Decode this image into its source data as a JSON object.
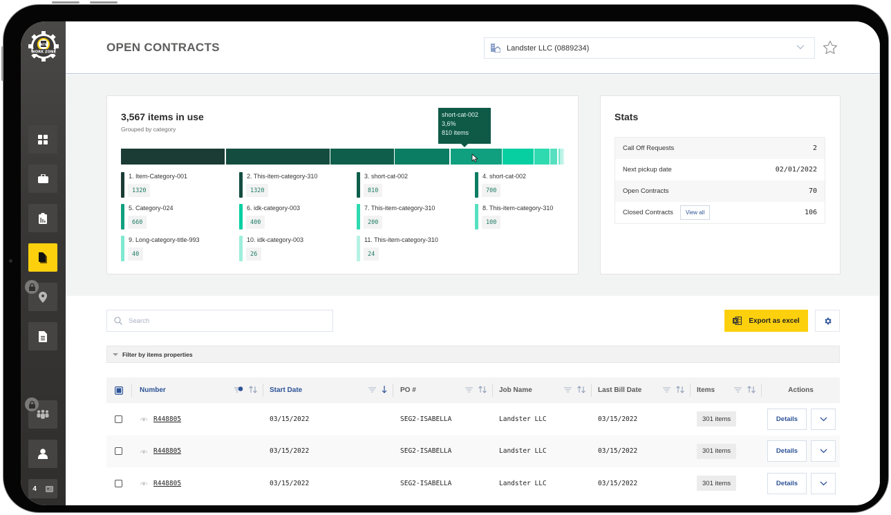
{
  "app": {
    "logo_label": "NTS WORK ZONE",
    "page_title": "OPEN CONTRACTS"
  },
  "sidebar": {
    "items": [
      {
        "name": "dashboard",
        "icon": "grid-icon",
        "active": false,
        "locked": false
      },
      {
        "name": "jobs",
        "icon": "briefcase-icon",
        "active": false,
        "locked": false
      },
      {
        "name": "reports",
        "icon": "clipboard-chart-icon",
        "active": false,
        "locked": false
      },
      {
        "name": "contracts",
        "icon": "documents-icon",
        "active": true,
        "locked": false
      },
      {
        "name": "locations",
        "icon": "location-pin-icon",
        "active": false,
        "locked": true
      },
      {
        "name": "invoices",
        "icon": "document-list-icon",
        "active": false,
        "locked": false
      },
      {
        "name": "team",
        "icon": "group-icon",
        "active": false,
        "locked": true
      },
      {
        "name": "profile",
        "icon": "user-icon",
        "active": false,
        "locked": false
      }
    ],
    "message_count": "4"
  },
  "header": {
    "company_select": {
      "value": "Landster LLC (0889234)",
      "icon": "buildings-icon"
    },
    "favorite_icon": "star-icon"
  },
  "usage_chart": {
    "title": "3,567 items in use",
    "subtitle": "Grouped by category",
    "tooltip": {
      "name": "short-cat-002",
      "percent": "3,6%",
      "items": "810 items"
    }
  },
  "chart_data": {
    "type": "bar",
    "subtype": "stacked-horizontal",
    "title": "3,567 items in use",
    "subtitle": "Grouped by category",
    "categories": [
      "1. Item-Category-001",
      "2. This-item-category-310",
      "3. short-cat-002",
      "4. short-cat-002",
      "5. Category-024",
      "6. idk-category-003",
      "7. This-item-category-310",
      "8. This-item-category-310",
      "9. Long-category-title-993",
      "10. idk-category-003",
      "11. This-item-category-310"
    ],
    "values": [
      1320,
      1320,
      810,
      700,
      660,
      400,
      200,
      100,
      40,
      26,
      24
    ],
    "value_labels": [
      "1320",
      "1320",
      "810",
      "700",
      "660",
      "400",
      "200",
      "100",
      "40",
      "26",
      "24"
    ],
    "colors": [
      "#1a3c34",
      "#144d40",
      "#0f5e4b",
      "#0b7d62",
      "#10a07f",
      "#08cfa2",
      "#2fdab0",
      "#56e0c0",
      "#7fe8d0",
      "#9eeedb",
      "#b6f2e4"
    ],
    "hovered_index": 4,
    "legend": "bottom"
  },
  "stats": {
    "title": "Stats",
    "rows": [
      {
        "label": "Call Off Requests",
        "value": "2"
      },
      {
        "label": "Next pickup date",
        "value": "02/01/2022"
      },
      {
        "label": "Open Contracts",
        "value": "70"
      },
      {
        "label": "Closed Contracts",
        "value": "106",
        "action": "View all"
      }
    ]
  },
  "toolbar": {
    "search_placeholder": "Search",
    "export_label": "Export as excel",
    "filter_label": "Filter by items properties"
  },
  "table": {
    "columns": [
      {
        "label": "Number",
        "filter_active": true,
        "sort": "none"
      },
      {
        "label": "Start Date",
        "filter_active": false,
        "sort": "desc"
      },
      {
        "label": "PO #",
        "filter_active": false,
        "sort": "none"
      },
      {
        "label": "Job Name",
        "filter_active": false,
        "sort": "none"
      },
      {
        "label": "Last Bill Date",
        "filter_active": false,
        "sort": "none"
      },
      {
        "label": "Items",
        "filter_active": false,
        "sort": "none"
      },
      {
        "label": "Actions"
      }
    ],
    "rows": [
      {
        "number": "R448805",
        "start_date": "03/15/2022",
        "po": "SEG2-ISABELLA",
        "job_name": "Landster LLC",
        "last_bill_date": "03/15/2022",
        "items": "301 items",
        "action": "Details"
      },
      {
        "number": "R448805",
        "start_date": "03/15/2022",
        "po": "SEG2-ISABELLA",
        "job_name": "Landster LLC",
        "last_bill_date": "03/15/2022",
        "items": "301 items",
        "action": "Details"
      },
      {
        "number": "R448805",
        "start_date": "03/15/2022",
        "po": "SEG2-ISABELLA",
        "job_name": "Landster LLC",
        "last_bill_date": "03/15/2022",
        "items": "301 items",
        "action": "Details"
      }
    ]
  }
}
